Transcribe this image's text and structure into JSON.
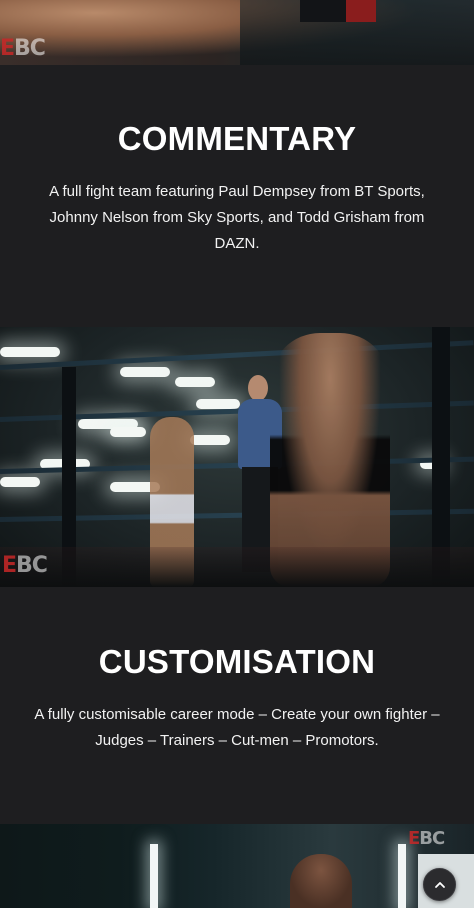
{
  "sections": [
    {
      "title": "COMMENTARY",
      "body": "A full fight team featuring Paul Dempsey from BT Sports, Johnny Nelson from Sky Sports, and Todd Grisham from DAZN."
    },
    {
      "title": "CUSTOMISATION",
      "body": "A fully customisable career mode – Create your own fighter – Judges – Trainers – Cut-men – Promotors."
    }
  ],
  "watermark": {
    "logo_text": "BC",
    "logo_prefix": "E"
  },
  "images": {
    "top": "boxing-screenshot-top",
    "middle": "boxing-ring-screenshot",
    "bottom": "boxing-gym-screenshot"
  },
  "icons": {
    "scroll_top": "chevron-up-icon"
  },
  "colors": {
    "background": "#1e1e20",
    "text": "#ffffff",
    "button": "#2b2b2e"
  }
}
